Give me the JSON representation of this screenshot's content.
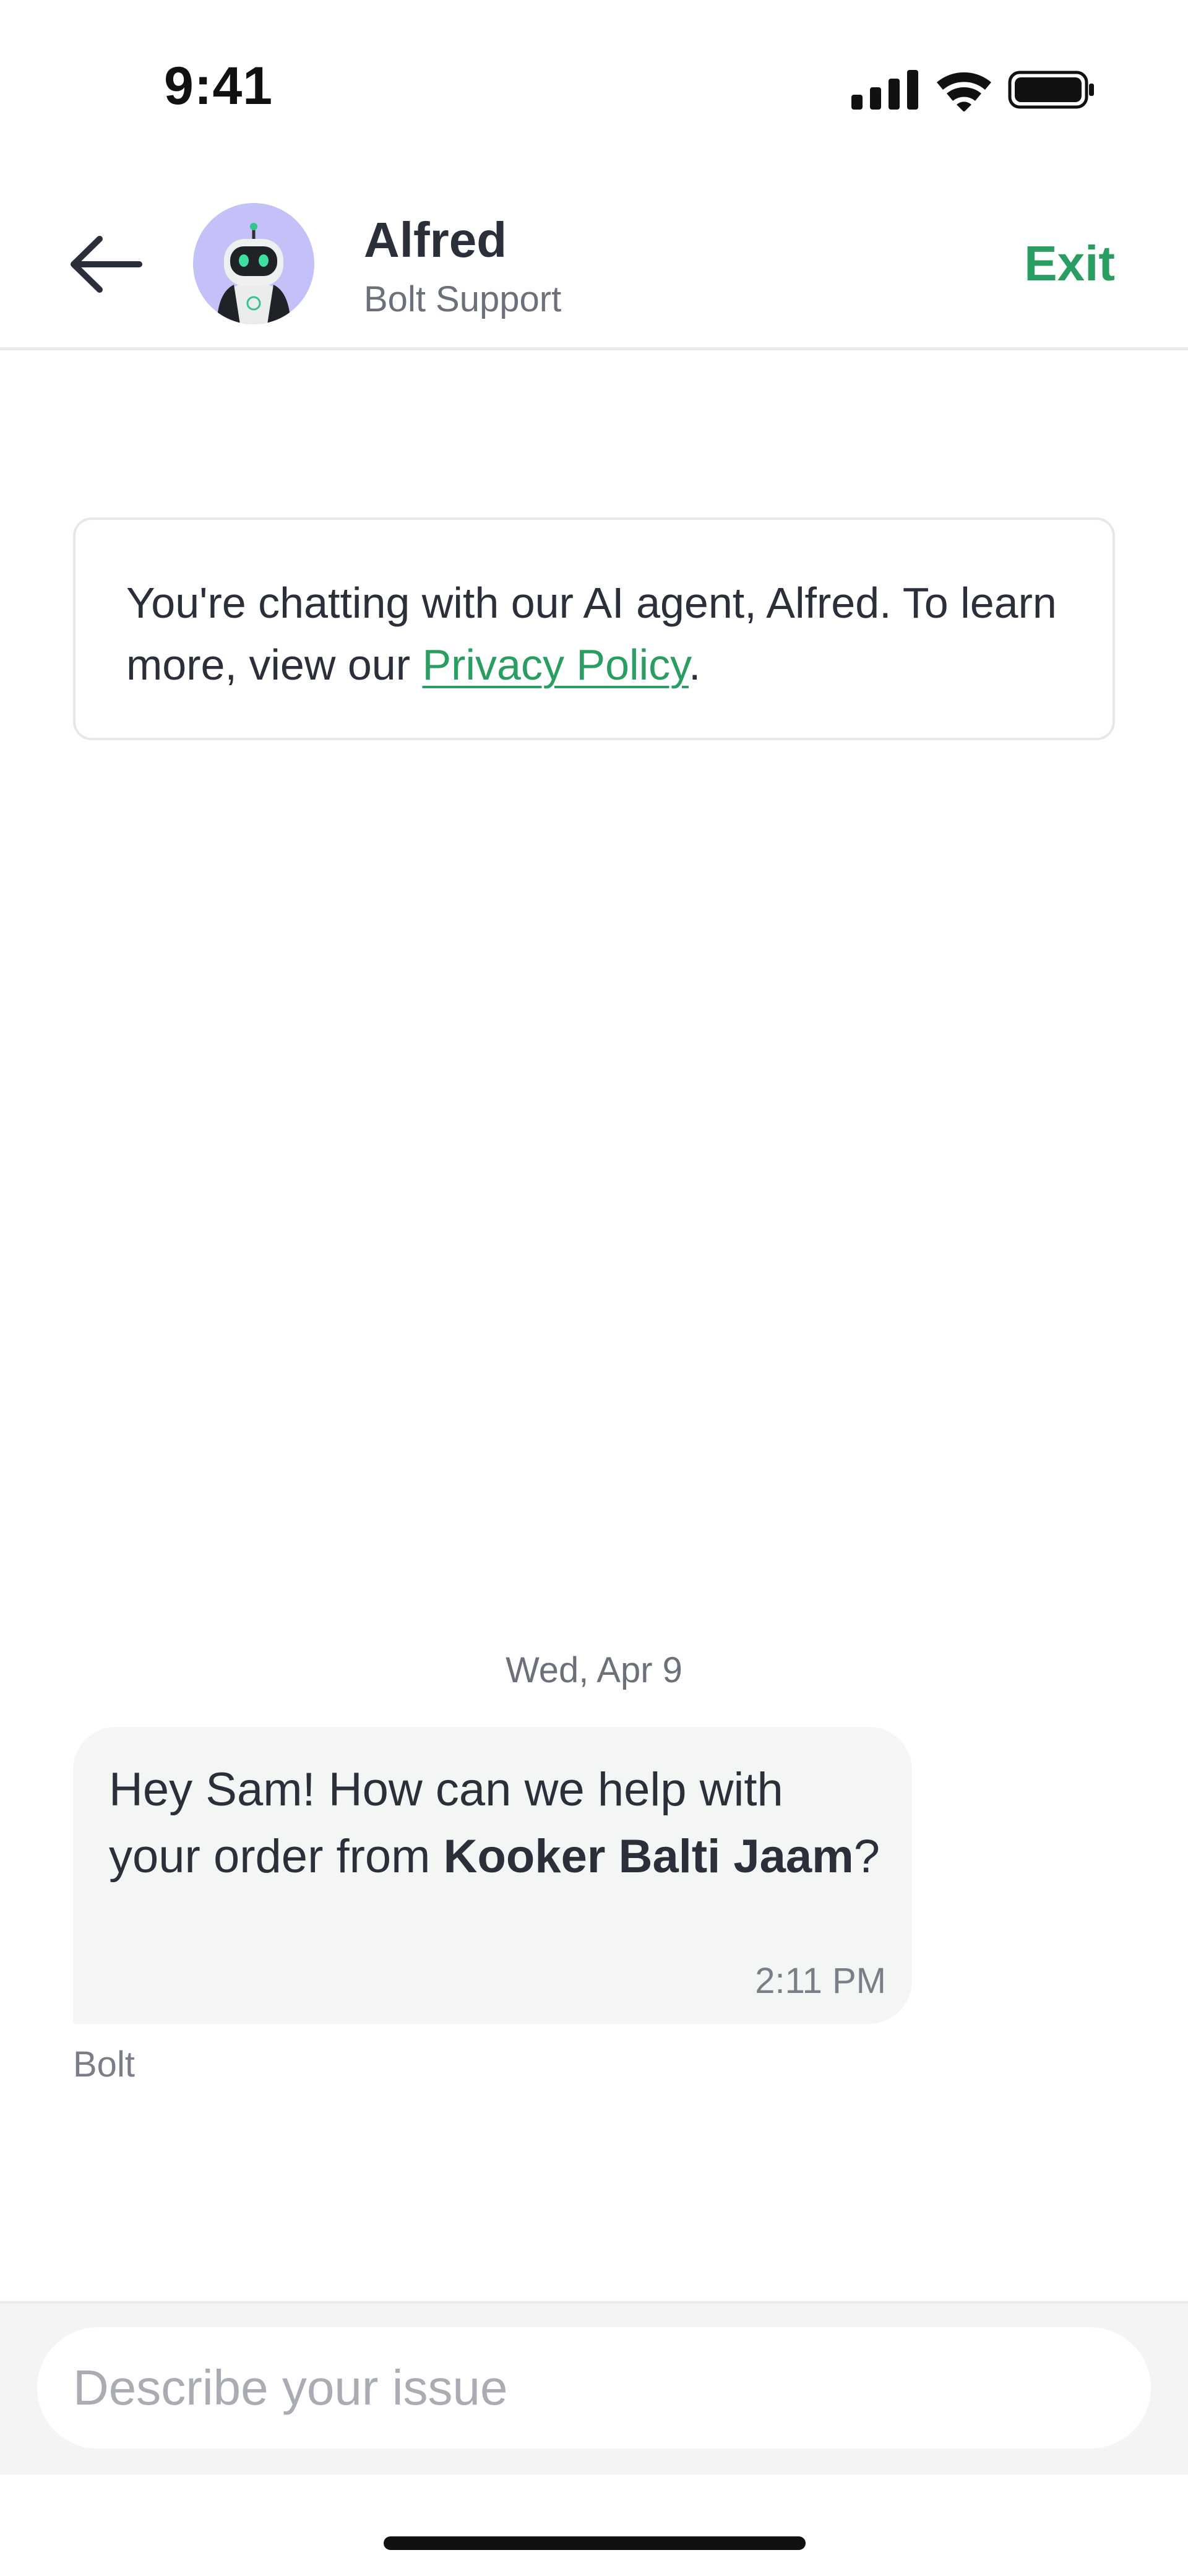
{
  "status_bar": {
    "time": "9:41"
  },
  "header": {
    "agent_name": "Alfred",
    "agent_subtitle": "Bolt Support",
    "exit_label": "Exit",
    "avatar_bg": "#c3c1f7",
    "accent": "#2a9d63"
  },
  "notice": {
    "text_before": "You're chatting with our AI agent, Alfred. To learn more, view our ",
    "link_text": "Privacy Policy",
    "text_after": "."
  },
  "conversation": {
    "date": "Wed, Apr 9",
    "messages": [
      {
        "text_before": "Hey Sam! How can we help with your order from ",
        "bold": "Kooker Balti Jaam",
        "text_after": "?",
        "time": "2:11 PM",
        "sender": "Bolt"
      }
    ]
  },
  "composer": {
    "placeholder": "Describe your issue",
    "value": ""
  }
}
